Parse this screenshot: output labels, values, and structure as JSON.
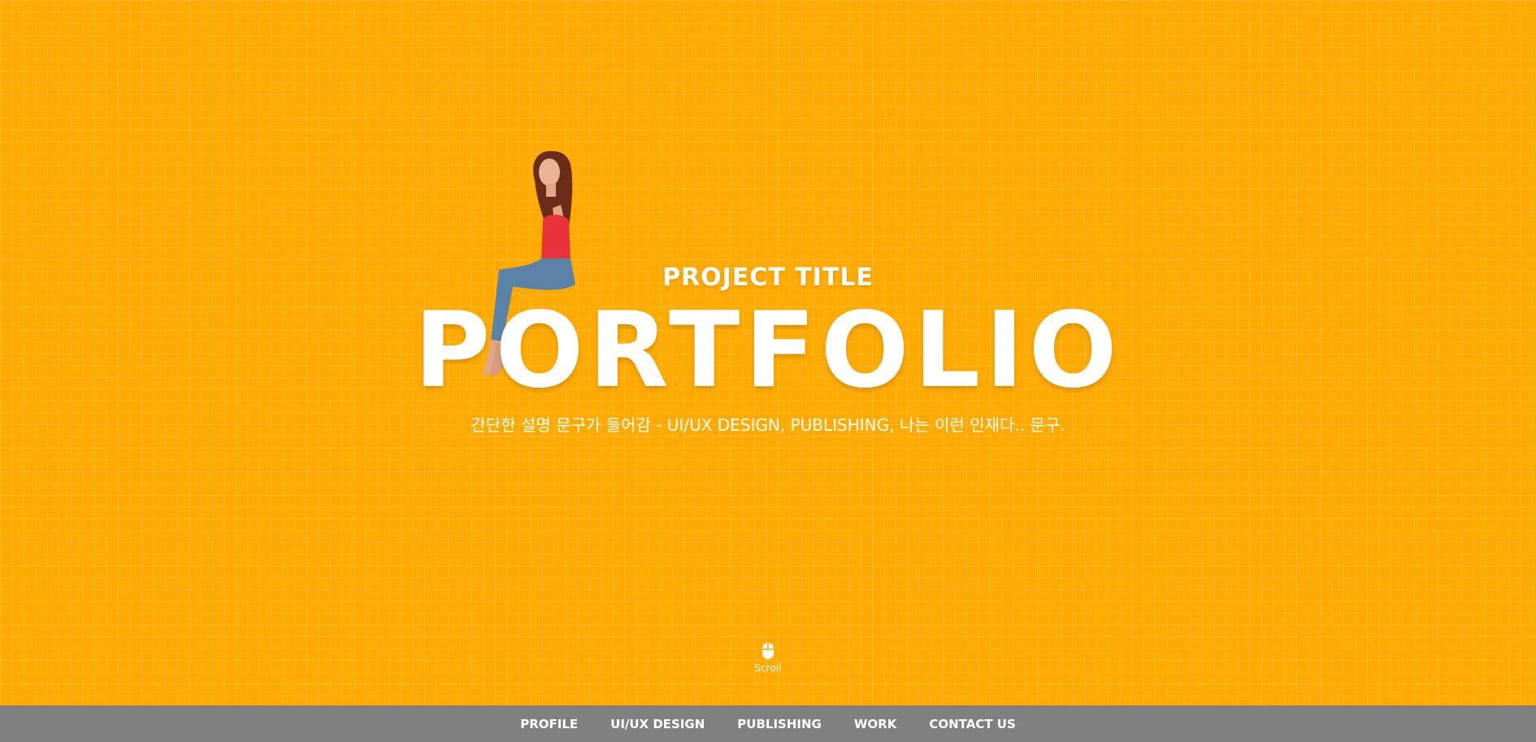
{
  "hero": {
    "project_title": "PROJECT TITLE",
    "portfolio": "PORTFOLIO",
    "description": "간단한 설명 문구가 들어감 - UI/UX DESIGN, PUBLISHING, 나는 이런 인재다.. 문구.",
    "figure_icon": "seated-woman-photo"
  },
  "scroll": {
    "icon": "mouse-icon",
    "label": "Scroll"
  },
  "nav": {
    "items": [
      {
        "label": "PROFILE"
      },
      {
        "label": "UI/UX DESIGN"
      },
      {
        "label": "PUBLISHING"
      },
      {
        "label": "WORK"
      },
      {
        "label": "CONTACT US"
      }
    ]
  },
  "colors": {
    "background": "#FFAA00",
    "nav_background": "#808080",
    "text": "#FFFFFF"
  }
}
